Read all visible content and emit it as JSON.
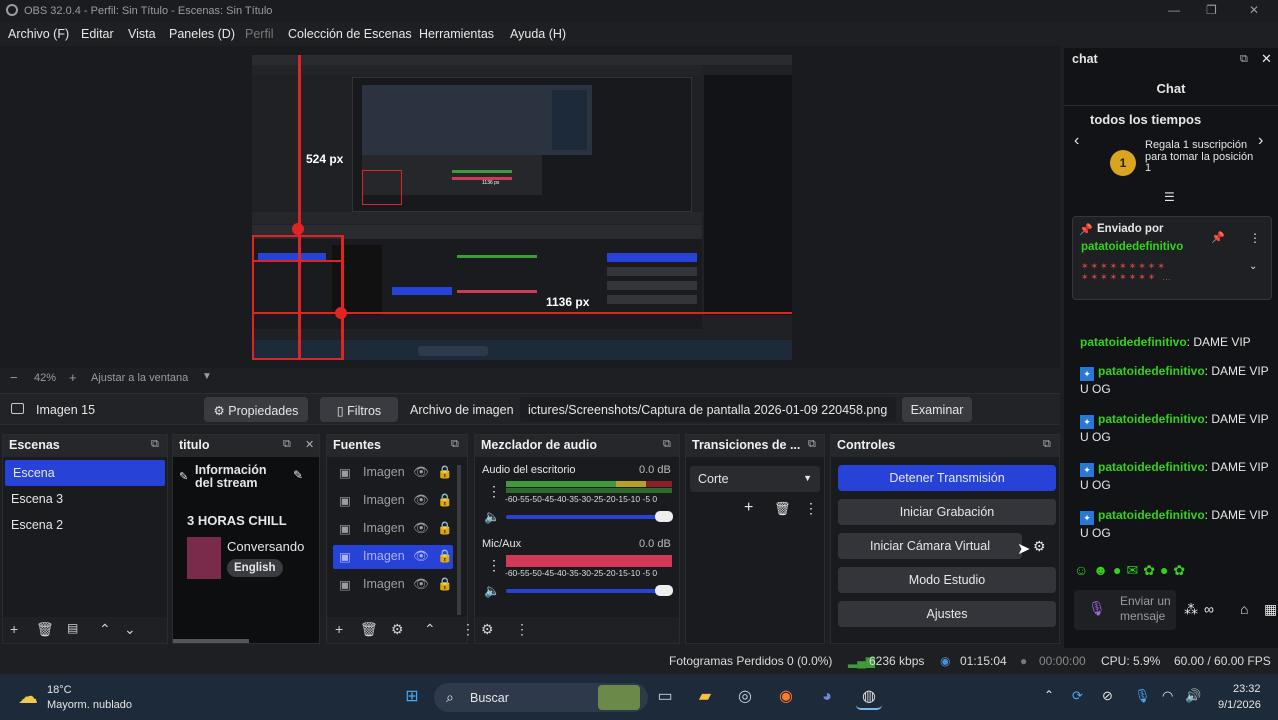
{
  "window": {
    "title": "OBS 32.0.4 - Perfil: Sin Título - Escenas: Sin Título"
  },
  "menu": [
    "Archivo (F)",
    "Editar",
    "Vista",
    "Paneles (D)",
    "Perfil",
    "Colección de Escenas",
    "Herramientas",
    "Ayuda (H)"
  ],
  "preview": {
    "label_524": "524 px",
    "label_1136_top": "1136 px",
    "label_1136": "1136 px",
    "zoom": "42%",
    "fit": "Ajustar a la ventana"
  },
  "source_bar": {
    "name": "Imagen 15",
    "properties": "Propiedades",
    "filters": "Filtros",
    "file_label": "Archivo de imagen",
    "file_path": "ictures/Screenshots/Captura de pantalla 2026-01-09 220458.png",
    "browse": "Examinar"
  },
  "scenes": {
    "title": "Escenas",
    "items": [
      "Escena",
      "Escena 3",
      "Escena 2"
    ]
  },
  "titulo": {
    "title": "titulo",
    "stream_info": "Información del stream",
    "stream_title": "3 HORAS CHILL",
    "category": "Conversando",
    "language": "English"
  },
  "sources": {
    "title": "Fuentes",
    "items": [
      "Imagen",
      "Imagen",
      "Imagen",
      "Imagen",
      "Imagen"
    ]
  },
  "mixer": {
    "title": "Mezclador de audio",
    "tracks": [
      {
        "name": "Audio del escritorio",
        "db": "0.0 dB"
      },
      {
        "name": "Mic/Aux",
        "db": "0.0 dB"
      }
    ],
    "scale": "-60-55-50-45-40-35-30-25-20-15-10 -5  0"
  },
  "transitions": {
    "title": "Transiciones de ...",
    "selected": "Corte"
  },
  "controls": {
    "title": "Controles",
    "buttons": [
      "Detener Transmisión",
      "Iniciar Grabación",
      "Iniciar Cámara Virtual",
      "Modo Estudio",
      "Ajustes"
    ]
  },
  "status": {
    "dropped": "Fotogramas Perdidos 0 (0.0%)",
    "bitrate": "6236 kbps",
    "stream_time": "01:15:04",
    "rec_time": "00:00:00",
    "cpu": "CPU: 5.9%",
    "fps": "60.00 / 60.00 FPS"
  },
  "chat": {
    "dock_title": "chat",
    "header": "Chat",
    "leaderboard_title": "todos los tiempos",
    "rank": "1",
    "gift_text": "Regala 1 suscripción para tomar la posición 1",
    "pinned_label": "Enviado por",
    "pinned_user": "patatoidedefinitivo",
    "messages": [
      {
        "user": "patatoidedefinitivo",
        "text": ": DAME VIP"
      },
      {
        "user": "patatoidedefinitivo",
        "text": ": DAME VIP U OG"
      },
      {
        "user": "patatoidedefinitivo",
        "text": ": DAME VIP U OG"
      },
      {
        "user": "patatoidedefinitivo",
        "text": ": DAME VIP U OG"
      },
      {
        "user": "patatoidedefinitivo",
        "text": ": DAME VIP U OG"
      }
    ],
    "input_placeholder": "Enviar un mensaje"
  },
  "taskbar": {
    "temp": "18°C",
    "weather": "Mayorm. nublado",
    "search": "Buscar",
    "time": "23:32",
    "date": "9/1/2026"
  },
  "colors": {
    "accent": "#2742d6",
    "red": "#e02424",
    "twitch_green": "#34d21a",
    "meter_green": "#3e9a3a",
    "meter_red": "#d13a56"
  }
}
